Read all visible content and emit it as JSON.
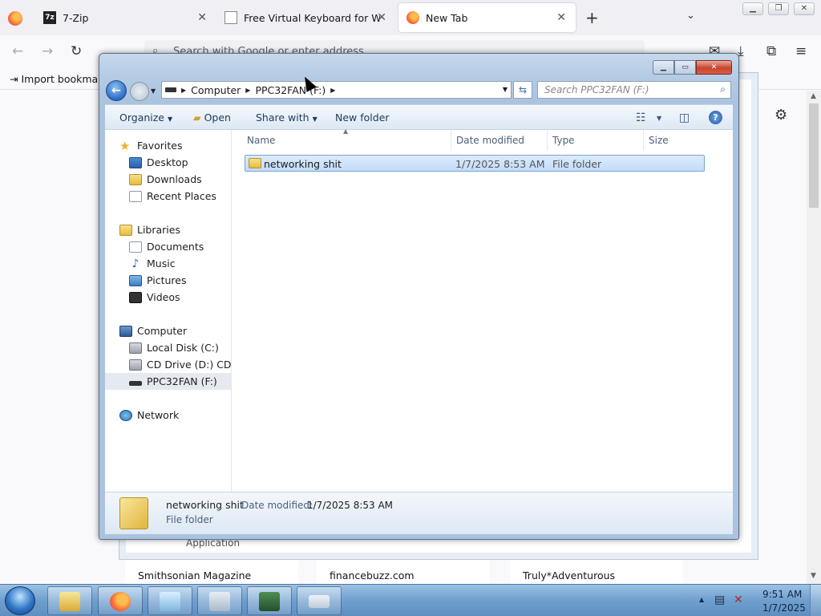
{
  "browser": {
    "tabs": [
      {
        "title": "7-Zip",
        "icon": "7zip-icon"
      },
      {
        "title": "Free Virtual Keyboard for Windo",
        "icon": "page-icon"
      },
      {
        "title": "New Tab",
        "icon": "firefox-icon"
      }
    ],
    "urlbar_placeholder": "Search with Google or enter address",
    "bookmark": "Import bookmarks...",
    "tiles": [
      "Smithsonian Magazine",
      "financebuzz.com",
      "Truly*Adventurous"
    ],
    "behind_text": "Application"
  },
  "explorer": {
    "breadcrumb": [
      "Computer",
      "PPC32FAN (F:)"
    ],
    "search_placeholder": "Search PPC32FAN (F:)",
    "toolbar": {
      "organize": "Organize",
      "open": "Open",
      "share_with": "Share with",
      "new_folder": "New folder"
    },
    "nav": {
      "favorites": "Favorites",
      "desktop": "Desktop",
      "downloads": "Downloads",
      "recent_places": "Recent Places",
      "libraries": "Libraries",
      "documents": "Documents",
      "music": "Music",
      "pictures": "Pictures",
      "videos": "Videos",
      "computer": "Computer",
      "local_disk": "Local Disk (C:)",
      "cd_drive": "CD Drive (D:) CDROM",
      "usb_drive": "PPC32FAN (F:)",
      "network": "Network"
    },
    "columns": {
      "name": "Name",
      "date_modified": "Date modified",
      "type": "Type",
      "size": "Size"
    },
    "files": [
      {
        "name": "networking shit",
        "date_modified": "1/7/2025 8:53 AM",
        "type": "File folder",
        "size": ""
      }
    ],
    "details": {
      "name": "networking shit",
      "date_label": "Date modified:",
      "date_value": "1/7/2025 8:53 AM",
      "type": "File folder"
    }
  },
  "taskbar": {
    "time": "9:51 AM",
    "date": "1/7/2025"
  },
  "colors": {
    "explorer_frame": "#b4cbe4",
    "selection": "#c1dcfa",
    "taskbar": "#6f9fce"
  }
}
